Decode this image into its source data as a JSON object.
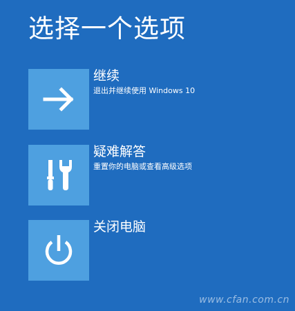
{
  "page": {
    "title": "选择一个选项"
  },
  "options": [
    {
      "label": "继续",
      "description": "退出并继续使用 Windows 10",
      "icon": "arrow-right-icon"
    },
    {
      "label": "疑难解答",
      "description": "重置你的电脑或查看高级选项",
      "icon": "tools-icon"
    },
    {
      "label": "关闭电脑",
      "description": "",
      "icon": "power-icon"
    }
  ],
  "watermark": {
    "text": "www.cfan.com.cn"
  },
  "colors": {
    "background": "#1f6cbf",
    "tile": "#4ea0e0",
    "text": "#ffffff"
  }
}
